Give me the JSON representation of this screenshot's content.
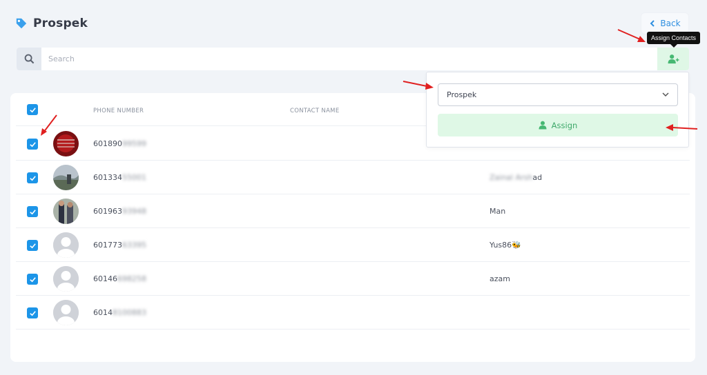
{
  "header": {
    "title": "Prospek",
    "icon": "tag-icon"
  },
  "back": {
    "label": "Back"
  },
  "tooltip": {
    "text": "Assign Contacts"
  },
  "search": {
    "placeholder": "Search"
  },
  "table": {
    "columns": {
      "phone": "PHONE NUMBER",
      "contact_name": "CONTACT NAME"
    },
    "rows": [
      {
        "phone_visible": "601890",
        "phone_blurred": "99599",
        "name": "",
        "avatar": "photo-red",
        "checked": true
      },
      {
        "phone_visible": "601334",
        "phone_blurred": "55001",
        "name_blurred": "Zainal Arsh",
        "name_visible": "ad",
        "avatar": "photo-landscape",
        "checked": true
      },
      {
        "phone_visible": "601963",
        "phone_blurred": "93948",
        "name": "Man",
        "avatar": "photo-people",
        "checked": true
      },
      {
        "phone_visible": "601773",
        "phone_blurred": "63395",
        "name": "Yus86",
        "name_emoji": "🐝",
        "avatar": "placeholder",
        "checked": true
      },
      {
        "phone_visible": "60146",
        "phone_blurred": "698258",
        "name": "azam",
        "avatar": "placeholder",
        "checked": true
      },
      {
        "phone_visible": "6014",
        "phone_blurred": "8100883",
        "name": "",
        "avatar": "placeholder",
        "checked": true
      }
    ]
  },
  "assign_panel": {
    "selected": "Prospek",
    "button_label": "Assign"
  },
  "colors": {
    "accent": "#1c95e8",
    "success": "#3ea86a",
    "arrow": "#e02020"
  }
}
